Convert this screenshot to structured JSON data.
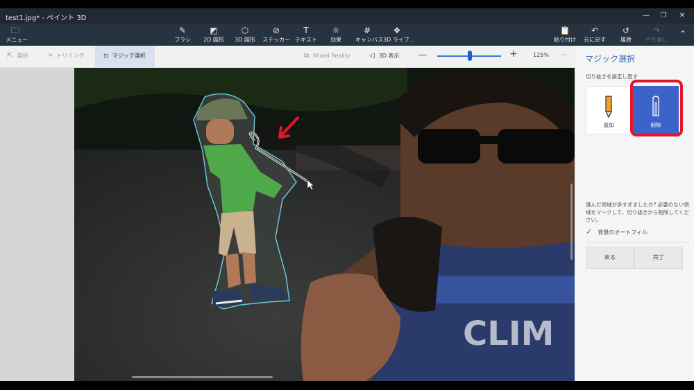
{
  "window": {
    "title": "test1.jpg* - ペイント 3D",
    "controls": [
      "—",
      "❐",
      "✕"
    ]
  },
  "ribbon": {
    "menu": "メニュー",
    "tools": [
      "ブラシ",
      "2D 図形",
      "3D 図形",
      "ステッカー",
      "テキスト",
      "効果",
      "キャンバス",
      "3D ライブ..."
    ],
    "right": [
      "貼り付け",
      "元に戻す",
      "履歴",
      "やり直し"
    ]
  },
  "toolbar": {
    "select": "選択",
    "crop": "トリミング",
    "magic_select": "マジック選択",
    "mixed_reality": "Mixed Reality",
    "view_3d": "3D 表示",
    "zoom_minus": "—",
    "zoom_plus": "+",
    "zoom_value": "125%",
    "more": "···",
    "zoom_level_fraction": 0.48
  },
  "panel": {
    "title": "マジック選択",
    "subtitle": "切り抜きを設定し直す",
    "add_label": "追加",
    "remove_label": "削除",
    "help": "選んだ領域が多すぎましたか? 必要のない領域をマークして、切り抜きから削除してください。",
    "autofill_label": "背景のオートフィル",
    "autofill_checked": true,
    "back_button": "戻る",
    "done_button": "完了"
  },
  "colors": {
    "accent": "#3c63c9",
    "highlight": "#e5142a",
    "selection_outline": "#6fd6e6"
  },
  "canvas": {
    "shirt_text": "CLIM"
  }
}
